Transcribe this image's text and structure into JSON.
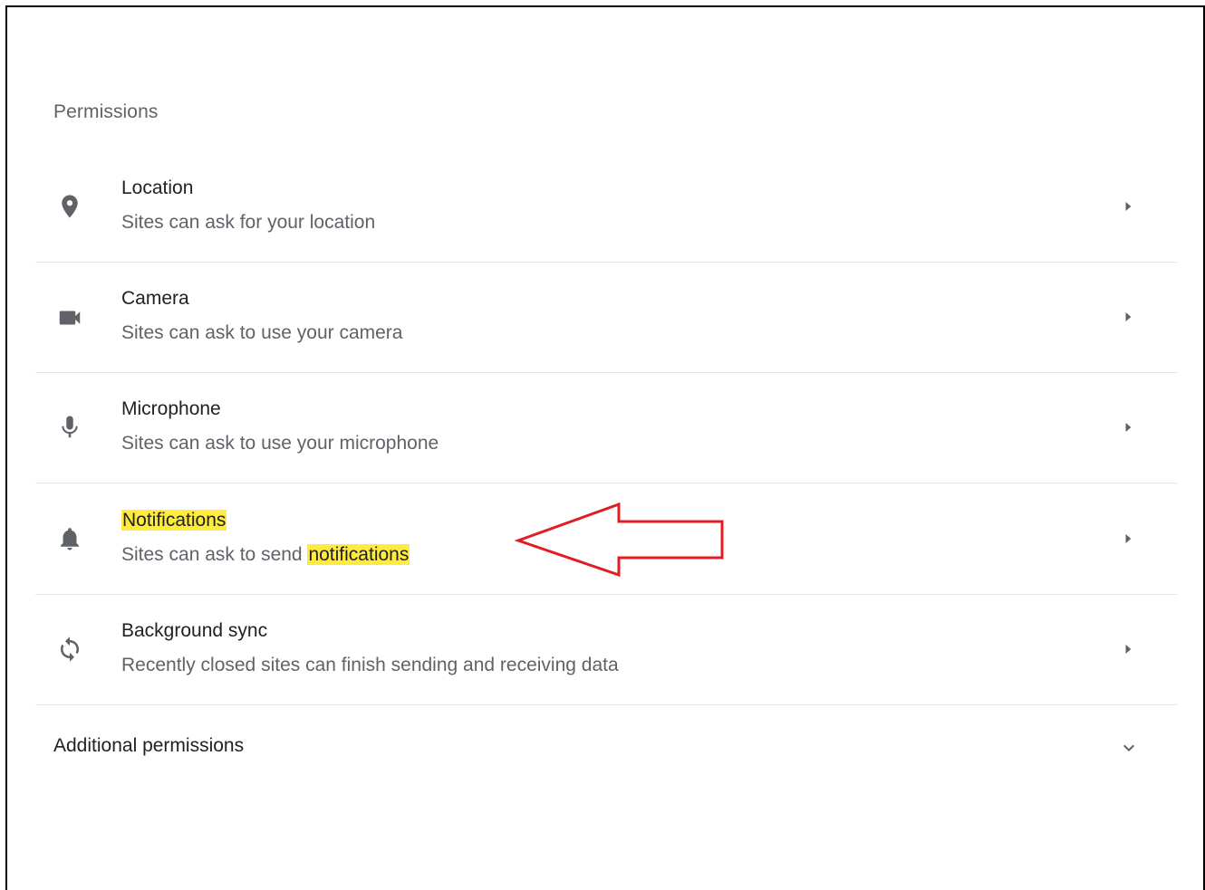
{
  "section_title": "Permissions",
  "rows": [
    {
      "title": "Location",
      "subtitle": "Sites can ask for your location",
      "icon": "location-pin-icon"
    },
    {
      "title": "Camera",
      "subtitle": "Sites can ask to use your camera",
      "icon": "camera-icon"
    },
    {
      "title": "Microphone",
      "subtitle": "Sites can ask to use your microphone",
      "icon": "microphone-icon"
    },
    {
      "title": "Notifications",
      "subtitle_prefix": "Sites can ask to send ",
      "subtitle_highlight": "notifications",
      "icon": "bell-icon",
      "highlight_color": "#ffeb3b"
    },
    {
      "title": "Background sync",
      "subtitle": "Recently closed sites can finish sending and receiving data",
      "icon": "sync-icon"
    }
  ],
  "additional_label": "Additional permissions",
  "annotation_color": "#e41b23"
}
